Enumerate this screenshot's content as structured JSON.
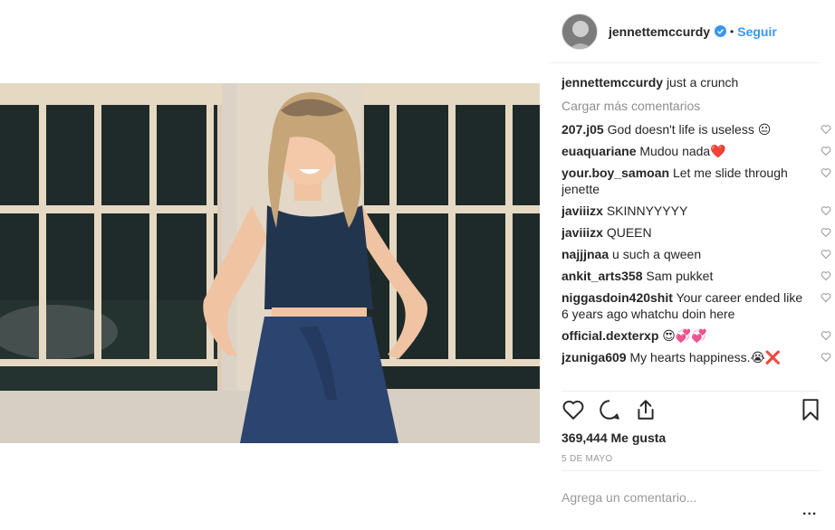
{
  "post": {
    "username": "jennettemccurdy",
    "follow_label": "Seguir",
    "dot": "•",
    "caption_user": "jennettemccurdy",
    "caption_text": "just a crunch",
    "load_more": "Cargar más comentarios",
    "likes": "369,444 Me gusta",
    "date": "5 DE MAYO",
    "add_comment_placeholder": "Agrega un comentario...",
    "more_options": "..."
  },
  "comments": [
    {
      "user": "207.j05",
      "text": "God doesn't life is useless 😐"
    },
    {
      "user": "euaquariane",
      "text": "Mudou nada❤️"
    },
    {
      "user": "your.boy_samoan",
      "text": "Let me slide through jenette"
    },
    {
      "user": "javiiizx",
      "text": "SKINNYYYYY"
    },
    {
      "user": "javiiizx",
      "text": "QUEEN"
    },
    {
      "user": "najjjnaa",
      "text": "u such a qween"
    },
    {
      "user": "ankit_arts358",
      "text": "Sam pukket"
    },
    {
      "user": "niggasdoin420shit",
      "text": "Your career ended like 6 years ago whatchu doin here"
    },
    {
      "user": "official.dexterxp",
      "text": "😍💞💞"
    },
    {
      "user": "jzuniga609",
      "text": "My hearts happiness.😭❌"
    }
  ],
  "icons": {
    "verified": "verified-badge-icon",
    "like": "heart-icon",
    "comment": "comment-bubble-icon",
    "share": "share-icon",
    "save": "bookmark-icon"
  },
  "colors": {
    "link": "#3897f0",
    "muted": "#8e8e8e",
    "text": "#262626"
  }
}
